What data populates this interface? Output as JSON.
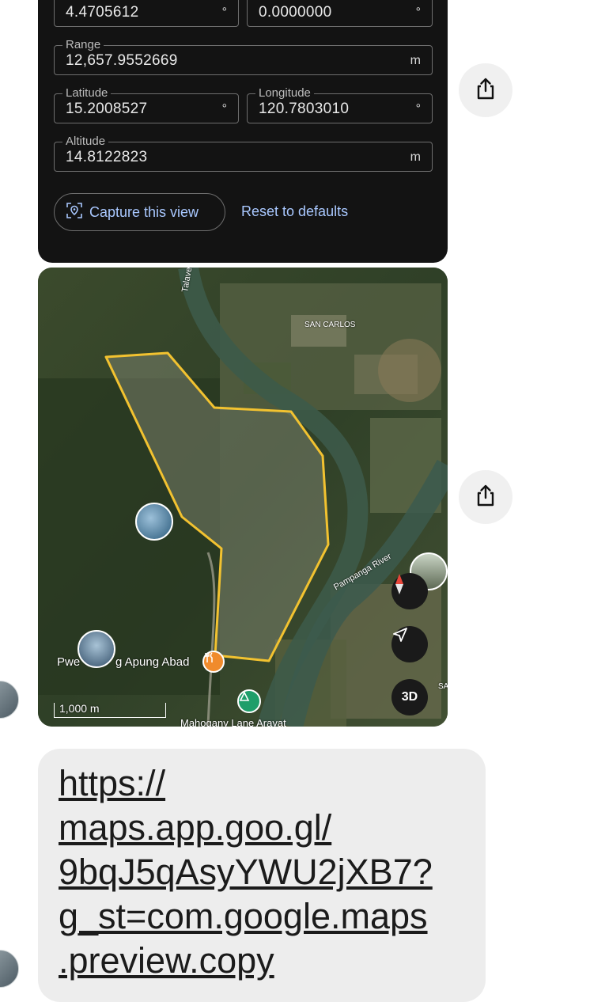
{
  "settings_card": {
    "fields": [
      {
        "label": "",
        "value": "4.4705612",
        "unit": "°"
      },
      {
        "label": "",
        "value": "0.0000000",
        "unit": "°"
      },
      {
        "label": "Range",
        "value": "12,657.9552669",
        "unit": "m"
      },
      {
        "label": "Latitude",
        "value": "15.2008527",
        "unit": "°"
      },
      {
        "label": "Longitude",
        "value": "120.7803010",
        "unit": "°"
      },
      {
        "label": "Altitude",
        "value": "14.8122823",
        "unit": "m"
      }
    ],
    "capture_label": "Capture this view",
    "reset_label": "Reset to defaults"
  },
  "map": {
    "labels": {
      "river_north": "Talavera Rive",
      "san_carlos": "SAN CARLOS",
      "pampanga": "Pampanga River",
      "place": "Pwe... ng Apung Abad",
      "place_visible": "Pwe",
      "place_rest": "g Apung Abad",
      "road": "Mahogany Lane Arayat",
      "edge": "SA"
    },
    "scale_label": "1,000 m",
    "btn_3d": "3D",
    "icons": [
      "compass-icon",
      "navigation-arrow-icon",
      "restaurant-pin-icon",
      "green-pin-icon"
    ]
  },
  "message": {
    "link_lines": [
      "https://",
      "maps.app.goo.gl/",
      "9bqJ5qAsyYWU2jXB7?",
      "g_st=com.google.maps",
      ".preview.copy"
    ]
  },
  "colors": {
    "card_bg": "#131313",
    "accent_link": "#a9c8ff",
    "polygon_outline": "#f2c230",
    "bubble_bg": "#ededed"
  }
}
